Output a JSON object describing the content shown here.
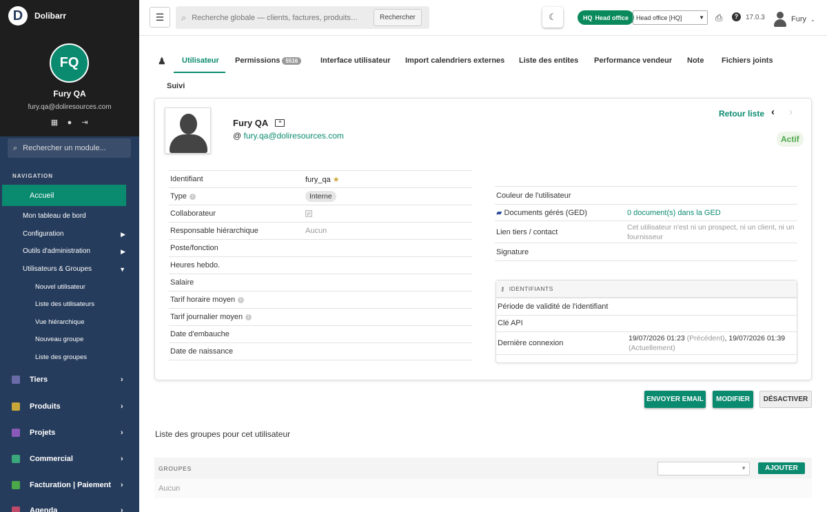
{
  "app": {
    "name": "Dolibarr",
    "version": "17.0.3"
  },
  "sidebar": {
    "initials": "FQ",
    "user_name": "Fury QA",
    "user_email": "fury.qa@doliresources.com",
    "module_search_placeholder": "Rechercher un module...",
    "nav_title": "NAVIGATION",
    "active_item": "Accueil",
    "items": [
      "Mon tableau de bord",
      "Configuration",
      "Outils d'administration",
      "Utilisateurs & Groupes"
    ],
    "subitems": [
      "Nouvel utilisateur",
      "Liste des utilisateurs",
      "Vue hiérarchique",
      "Nouveau groupe",
      "Liste des groupes"
    ],
    "modules": [
      {
        "label": "Tiers",
        "color": "#6a6aa8"
      },
      {
        "label": "Produits",
        "color": "#c9a83a"
      },
      {
        "label": "Projets",
        "color": "#8a5ab8"
      },
      {
        "label": "Commercial",
        "color": "#3aa87a"
      },
      {
        "label": "Facturation | Paiement",
        "color": "#4aa84a"
      },
      {
        "label": "Agenda",
        "color": "#c04a6a"
      }
    ]
  },
  "topbar": {
    "search_placeholder": "Recherche globale — clients, factures, produits…",
    "search_button": "Rechercher",
    "entity_badge_code": "HQ",
    "entity_badge_name": "Head office",
    "entity_select": "Head office [HQ]",
    "user": "Fury"
  },
  "tabs": {
    "utilisateur": "Utilisateur",
    "permissions": "Permissions",
    "permissions_count": "5516",
    "interface": "Interface utilisateur",
    "import": "Import calendriers externes",
    "entites": "Liste des entites",
    "performance": "Performance vendeur",
    "note": "Note",
    "fichiers": "Fichiers joints",
    "suivi": "Suivi"
  },
  "card": {
    "name": "Fury QA",
    "email": "fury.qa@doliresources.com",
    "back_link": "Retour liste",
    "status": "Actif",
    "left_fields": {
      "identifiant": {
        "label": "Identifiant",
        "value": "fury_qa"
      },
      "type": {
        "label": "Type",
        "value": "Interne"
      },
      "collaborateur": {
        "label": "Collaborateur",
        "value": "✓"
      },
      "responsable": {
        "label": "Responsable hiérarchique",
        "value": "Aucun"
      },
      "poste": {
        "label": "Poste/fonction",
        "value": ""
      },
      "heures": {
        "label": "Heures hebdo.",
        "value": ""
      },
      "salaire": {
        "label": "Salaire",
        "value": ""
      },
      "tarif_horaire": {
        "label": "Tarif horaire moyen",
        "value": ""
      },
      "tarif_journalier": {
        "label": "Tarif journalier moyen",
        "value": ""
      },
      "embauche": {
        "label": "Date d'embauche",
        "value": ""
      },
      "naissance": {
        "label": "Date de naissance",
        "value": ""
      }
    },
    "right_fields": {
      "couleur": {
        "label": "Couleur de l'utilisateur",
        "value": ""
      },
      "ged": {
        "label": "Documents gérés (GED)",
        "value": "0 document(s) dans la GED"
      },
      "tiers": {
        "label": "Lien tiers / contact",
        "value": "Cet utilisateur n'est ni un prospect, ni un client, ni un fournisseur"
      },
      "signature": {
        "label": "Signature",
        "value": ""
      }
    },
    "identifiants": {
      "title": "IDENTIFIANTS",
      "validite": "Période de validité de l'identifiant",
      "cle_api": "Clé API",
      "derniere_label": "Dernière connexion",
      "last_prev_date": "19/07/2026 01:23",
      "last_prev_tag": "(Précédent)",
      "last_cur_date": "19/07/2026 01:39",
      "last_cur_tag": "(Actuellement)"
    }
  },
  "actions": {
    "email": "ENVOYER EMAIL",
    "modifier": "MODIFIER",
    "desactiver": "DÉSACTIVER"
  },
  "groups": {
    "title": "Liste des groupes pour cet utilisateur",
    "header": "GROUPES",
    "add_button": "AJOUTER",
    "empty": "Aucun"
  }
}
